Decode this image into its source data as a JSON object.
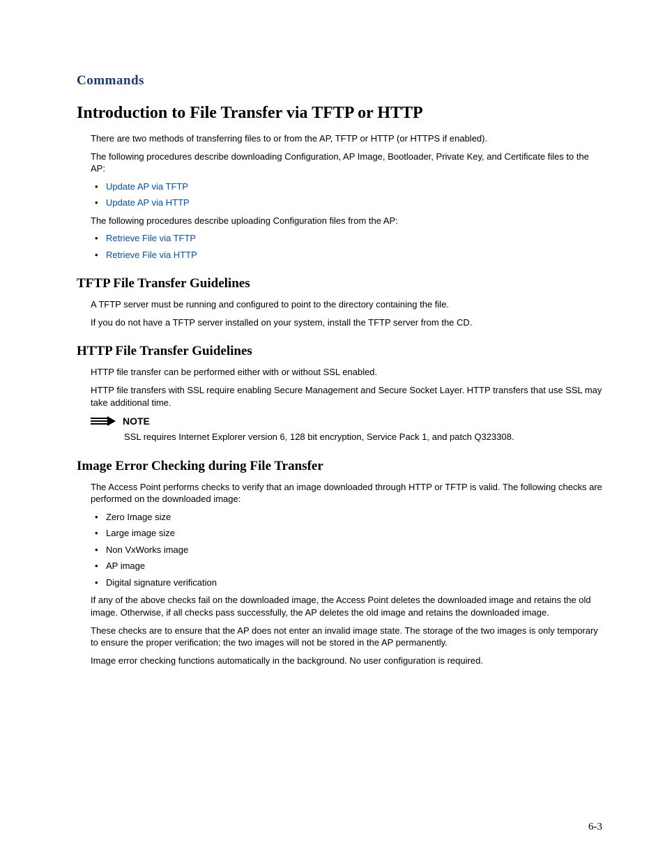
{
  "chapter": "Commands",
  "title": "Introduction to File Transfer via TFTP or HTTP",
  "intro": {
    "p1": "There are two methods of transferring files to or from the AP, TFTP or HTTP (or HTTPS if enabled).",
    "p2": "The following procedures describe downloading Configuration, AP Image, Bootloader, Private Key, and Certificate files to the AP:",
    "links1": {
      "a": "Update AP via TFTP",
      "b": "Update AP via HTTP"
    },
    "p3": "The following procedures describe uploading Configuration files from the AP:",
    "links2": {
      "a": "Retrieve File via TFTP",
      "b": "Retrieve File via HTTP"
    }
  },
  "tftp": {
    "heading": "TFTP File Transfer Guidelines",
    "p1": "A TFTP server must be running and configured to point to the directory containing the file.",
    "p2": "If you do not have a TFTP server installed on your system, install the TFTP server from the CD."
  },
  "http": {
    "heading": "HTTP File Transfer Guidelines",
    "p1": "HTTP file transfer can be performed either with or without SSL enabled.",
    "p2": "HTTP file transfers with SSL require enabling Secure Management and Secure Socket Layer. HTTP transfers that use SSL may take additional time."
  },
  "note": {
    "label": "NOTE",
    "text": "SSL requires Internet Explorer version 6, 128 bit encryption, Service Pack 1, and patch Q323308."
  },
  "imageerr": {
    "heading": "Image Error Checking during File Transfer",
    "p1": "The Access Point performs checks to verify that an image downloaded through HTTP or TFTP is valid. The following checks are performed on the downloaded image:",
    "bullets": {
      "a": "Zero Image size",
      "b": "Large image size",
      "c": "Non VxWorks image",
      "d": "AP image",
      "e": "Digital signature verification"
    },
    "p2": "If any of the above checks fail on the downloaded image, the Access Point deletes the downloaded image and retains the old image. Otherwise, if all checks pass successfully, the AP deletes the old image and retains the downloaded image.",
    "p3": "These checks are to ensure that the AP does not enter an invalid image state. The storage of the two images is only temporary to ensure the proper verification; the two images will not be stored in the AP permanently.",
    "p4": "Image error checking functions automatically in the background. No user configuration is required."
  },
  "pagenum": "6-3"
}
